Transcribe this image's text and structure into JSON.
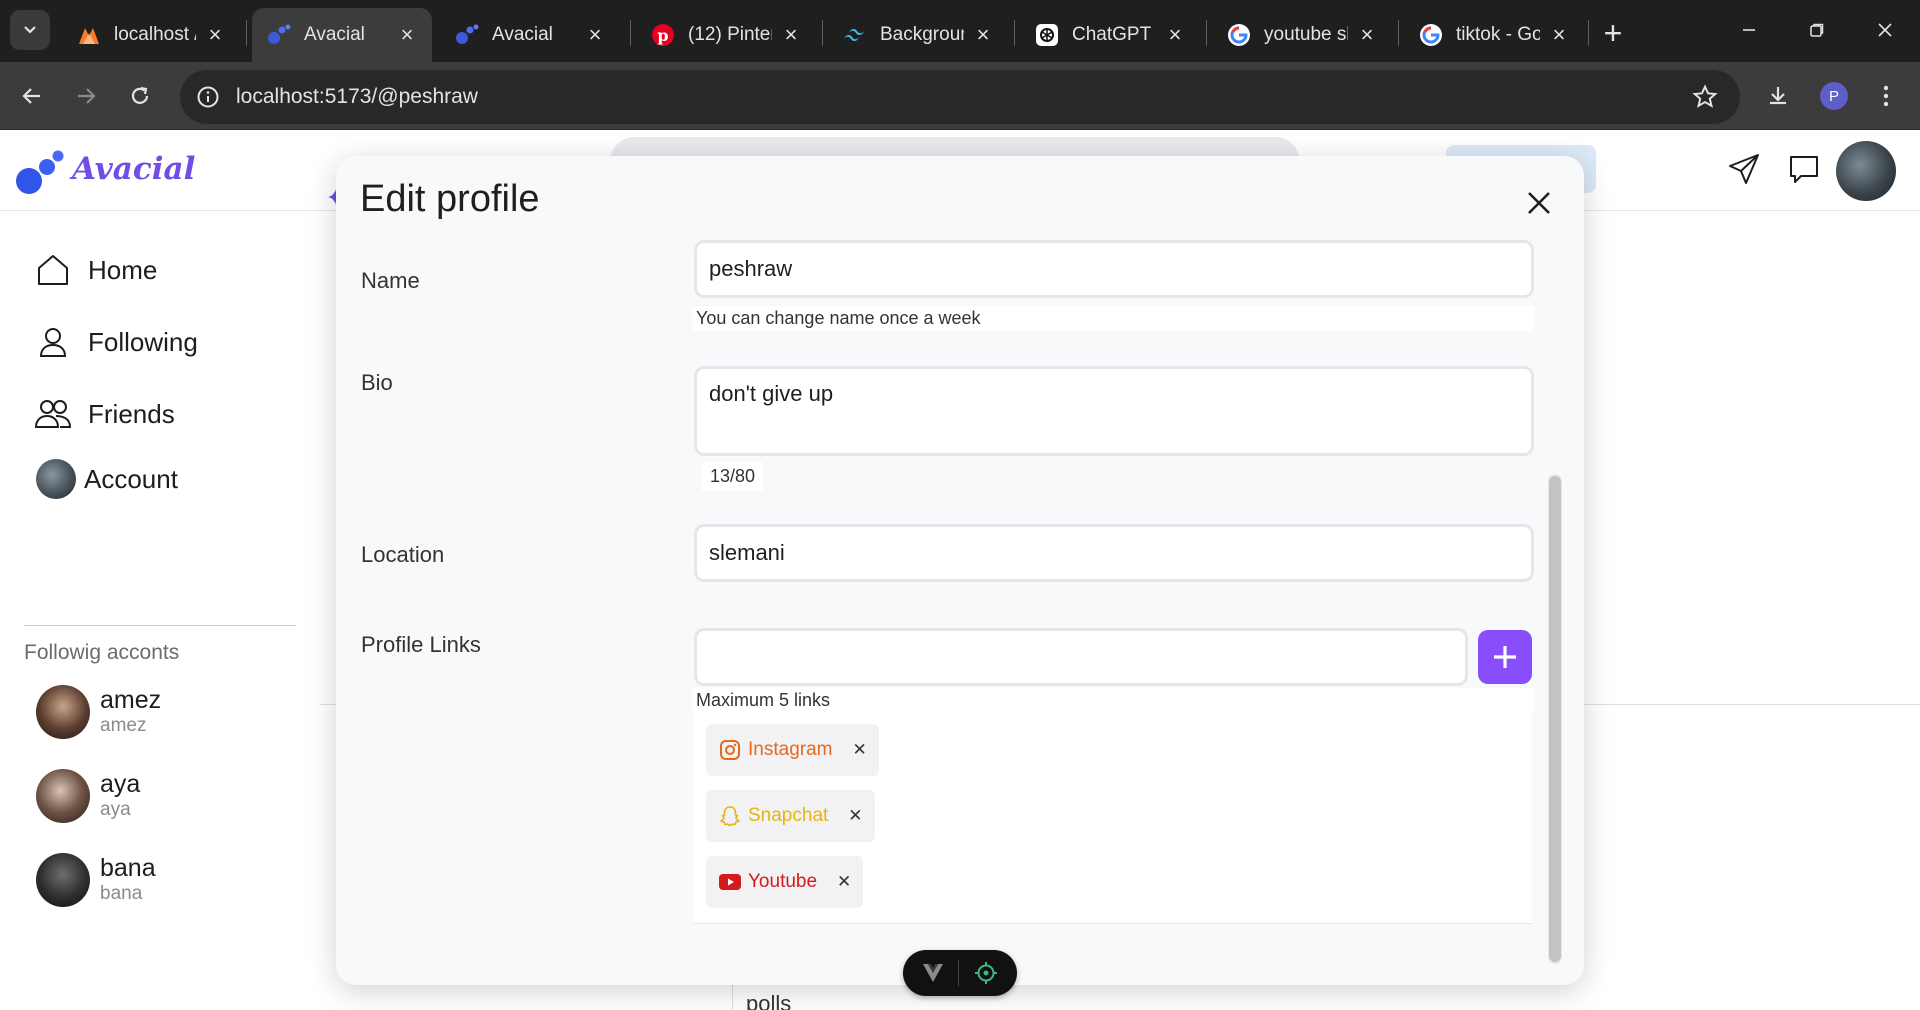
{
  "browser": {
    "tabs": [
      {
        "title": "localhost /",
        "icon": "xampp-icon"
      },
      {
        "title": "Avacial",
        "icon": "avacial-icon",
        "active": true
      },
      {
        "title": "Avacial",
        "icon": "avacial-icon"
      },
      {
        "title": "(12) Pinter",
        "icon": "pinterest-icon"
      },
      {
        "title": "Backgroun",
        "icon": "tailwind-icon"
      },
      {
        "title": "ChatGPT",
        "icon": "chatgpt-icon"
      },
      {
        "title": "youtube sl",
        "icon": "google-icon"
      },
      {
        "title": "tiktok - Go",
        "icon": "google-icon"
      }
    ],
    "url": "localhost:5173/@peshraw",
    "profile_initial": "P",
    "colors": {
      "tabbar": "#1f1f1f",
      "toolbar": "#3c3c3c",
      "omnibox": "#282828"
    }
  },
  "app": {
    "brand": "Avacial",
    "brand_color": "#6f4de6",
    "accent": "#8a4dfb"
  },
  "sidebar": {
    "items": [
      {
        "label": "Home",
        "icon": "home-icon"
      },
      {
        "label": "Following",
        "icon": "user-icon"
      },
      {
        "label": "Friends",
        "icon": "friends-icon"
      },
      {
        "label": "Account",
        "icon": "avatar"
      }
    ],
    "following_heading": "Followig acconts",
    "following": [
      {
        "name": "amez",
        "handle": "amez"
      },
      {
        "name": "aya",
        "handle": "aya"
      },
      {
        "name": "bana",
        "handle": "bana"
      }
    ]
  },
  "background": {
    "polls": "polls"
  },
  "modal": {
    "title": "Edit profile",
    "name_label": "Name",
    "name_value": "peshraw",
    "name_hint": "You can change name once a week",
    "bio_label": "Bio",
    "bio_value": "don't give up",
    "bio_count": "13/80",
    "location_label": "Location",
    "location_value": "slemani",
    "links_label": "Profile Links",
    "links_input_value": "",
    "links_hint": "Maximum 5 links",
    "links": [
      {
        "label": "Instagram",
        "color": "#e56a1e",
        "icon": "instagram-icon"
      },
      {
        "label": "Snapchat",
        "color": "#e7b40c",
        "icon": "snapchat-icon"
      },
      {
        "label": "Youtube",
        "color": "#d41a1a",
        "icon": "youtube-icon"
      }
    ],
    "remove_glyph": "✕"
  }
}
